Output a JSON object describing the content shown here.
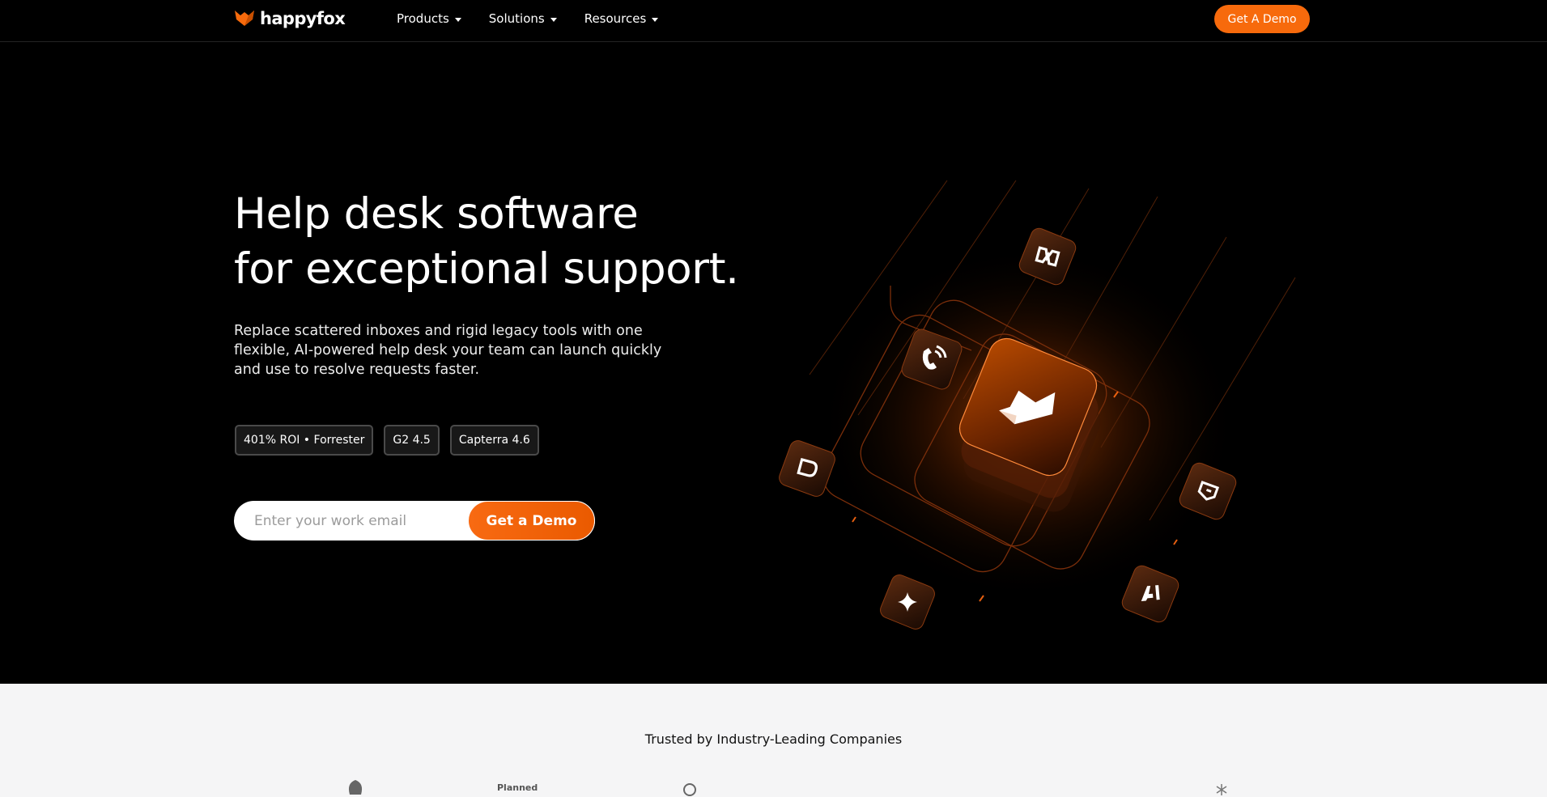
{
  "brand": {
    "name": "happyfox",
    "accent": "#f76a0c"
  },
  "nav": {
    "items": [
      {
        "label": "Products"
      },
      {
        "label": "Solutions"
      },
      {
        "label": "Resources"
      }
    ],
    "cta": "Get A Demo"
  },
  "hero": {
    "headline_line1": "Help desk software",
    "headline_line2": "for exceptional support.",
    "subcopy": "Replace scattered inboxes and rigid legacy tools with one flexible, AI-powered help desk your team can launch quickly and use to resolve requests faster.",
    "badges": [
      "401% ROI • Forrester",
      "G2 4.5",
      "Capterra 4.6"
    ],
    "email_placeholder": "Enter your work email",
    "email_button": "Get a Demo",
    "icons": [
      "inbox-icon",
      "phone-icon",
      "chat-icon",
      "sparkle-icon",
      "ai-icon",
      "workflow-icon",
      "diamond-icon"
    ]
  },
  "trusted": {
    "title": "Trusted by Industry-Leading Companies",
    "logos": [
      "Planned"
    ]
  }
}
